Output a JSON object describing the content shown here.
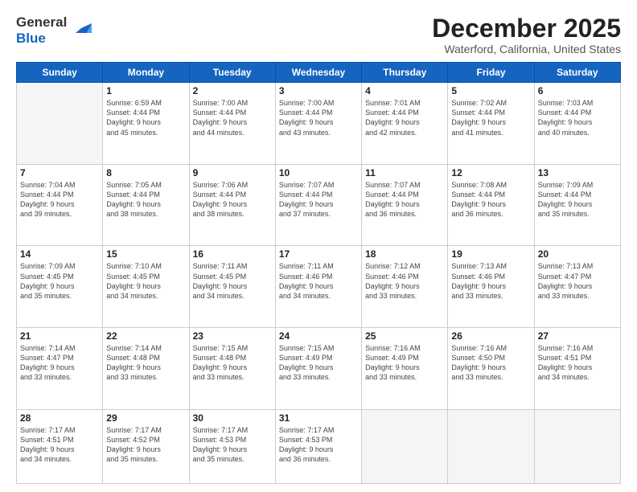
{
  "logo": {
    "general": "General",
    "blue": "Blue"
  },
  "title": "December 2025",
  "subtitle": "Waterford, California, United States",
  "days_of_week": [
    "Sunday",
    "Monday",
    "Tuesday",
    "Wednesday",
    "Thursday",
    "Friday",
    "Saturday"
  ],
  "weeks": [
    [
      {
        "day": "",
        "empty": true
      },
      {
        "day": "1",
        "sunrise": "Sunrise: 6:59 AM",
        "sunset": "Sunset: 4:44 PM",
        "daylight": "Daylight: 9 hours and 45 minutes."
      },
      {
        "day": "2",
        "sunrise": "Sunrise: 7:00 AM",
        "sunset": "Sunset: 4:44 PM",
        "daylight": "Daylight: 9 hours and 44 minutes."
      },
      {
        "day": "3",
        "sunrise": "Sunrise: 7:00 AM",
        "sunset": "Sunset: 4:44 PM",
        "daylight": "Daylight: 9 hours and 43 minutes."
      },
      {
        "day": "4",
        "sunrise": "Sunrise: 7:01 AM",
        "sunset": "Sunset: 4:44 PM",
        "daylight": "Daylight: 9 hours and 42 minutes."
      },
      {
        "day": "5",
        "sunrise": "Sunrise: 7:02 AM",
        "sunset": "Sunset: 4:44 PM",
        "daylight": "Daylight: 9 hours and 41 minutes."
      },
      {
        "day": "6",
        "sunrise": "Sunrise: 7:03 AM",
        "sunset": "Sunset: 4:44 PM",
        "daylight": "Daylight: 9 hours and 40 minutes."
      }
    ],
    [
      {
        "day": "7",
        "sunrise": "Sunrise: 7:04 AM",
        "sunset": "Sunset: 4:44 PM",
        "daylight": "Daylight: 9 hours and 39 minutes."
      },
      {
        "day": "8",
        "sunrise": "Sunrise: 7:05 AM",
        "sunset": "Sunset: 4:44 PM",
        "daylight": "Daylight: 9 hours and 38 minutes."
      },
      {
        "day": "9",
        "sunrise": "Sunrise: 7:06 AM",
        "sunset": "Sunset: 4:44 PM",
        "daylight": "Daylight: 9 hours and 38 minutes."
      },
      {
        "day": "10",
        "sunrise": "Sunrise: 7:07 AM",
        "sunset": "Sunset: 4:44 PM",
        "daylight": "Daylight: 9 hours and 37 minutes."
      },
      {
        "day": "11",
        "sunrise": "Sunrise: 7:07 AM",
        "sunset": "Sunset: 4:44 PM",
        "daylight": "Daylight: 9 hours and 36 minutes."
      },
      {
        "day": "12",
        "sunrise": "Sunrise: 7:08 AM",
        "sunset": "Sunset: 4:44 PM",
        "daylight": "Daylight: 9 hours and 36 minutes."
      },
      {
        "day": "13",
        "sunrise": "Sunrise: 7:09 AM",
        "sunset": "Sunset: 4:44 PM",
        "daylight": "Daylight: 9 hours and 35 minutes."
      }
    ],
    [
      {
        "day": "14",
        "sunrise": "Sunrise: 7:09 AM",
        "sunset": "Sunset: 4:45 PM",
        "daylight": "Daylight: 9 hours and 35 minutes."
      },
      {
        "day": "15",
        "sunrise": "Sunrise: 7:10 AM",
        "sunset": "Sunset: 4:45 PM",
        "daylight": "Daylight: 9 hours and 34 minutes."
      },
      {
        "day": "16",
        "sunrise": "Sunrise: 7:11 AM",
        "sunset": "Sunset: 4:45 PM",
        "daylight": "Daylight: 9 hours and 34 minutes."
      },
      {
        "day": "17",
        "sunrise": "Sunrise: 7:11 AM",
        "sunset": "Sunset: 4:46 PM",
        "daylight": "Daylight: 9 hours and 34 minutes."
      },
      {
        "day": "18",
        "sunrise": "Sunrise: 7:12 AM",
        "sunset": "Sunset: 4:46 PM",
        "daylight": "Daylight: 9 hours and 33 minutes."
      },
      {
        "day": "19",
        "sunrise": "Sunrise: 7:13 AM",
        "sunset": "Sunset: 4:46 PM",
        "daylight": "Daylight: 9 hours and 33 minutes."
      },
      {
        "day": "20",
        "sunrise": "Sunrise: 7:13 AM",
        "sunset": "Sunset: 4:47 PM",
        "daylight": "Daylight: 9 hours and 33 minutes."
      }
    ],
    [
      {
        "day": "21",
        "sunrise": "Sunrise: 7:14 AM",
        "sunset": "Sunset: 4:47 PM",
        "daylight": "Daylight: 9 hours and 33 minutes."
      },
      {
        "day": "22",
        "sunrise": "Sunrise: 7:14 AM",
        "sunset": "Sunset: 4:48 PM",
        "daylight": "Daylight: 9 hours and 33 minutes."
      },
      {
        "day": "23",
        "sunrise": "Sunrise: 7:15 AM",
        "sunset": "Sunset: 4:48 PM",
        "daylight": "Daylight: 9 hours and 33 minutes."
      },
      {
        "day": "24",
        "sunrise": "Sunrise: 7:15 AM",
        "sunset": "Sunset: 4:49 PM",
        "daylight": "Daylight: 9 hours and 33 minutes."
      },
      {
        "day": "25",
        "sunrise": "Sunrise: 7:16 AM",
        "sunset": "Sunset: 4:49 PM",
        "daylight": "Daylight: 9 hours and 33 minutes."
      },
      {
        "day": "26",
        "sunrise": "Sunrise: 7:16 AM",
        "sunset": "Sunset: 4:50 PM",
        "daylight": "Daylight: 9 hours and 33 minutes."
      },
      {
        "day": "27",
        "sunrise": "Sunrise: 7:16 AM",
        "sunset": "Sunset: 4:51 PM",
        "daylight": "Daylight: 9 hours and 34 minutes."
      }
    ],
    [
      {
        "day": "28",
        "sunrise": "Sunrise: 7:17 AM",
        "sunset": "Sunset: 4:51 PM",
        "daylight": "Daylight: 9 hours and 34 minutes."
      },
      {
        "day": "29",
        "sunrise": "Sunrise: 7:17 AM",
        "sunset": "Sunset: 4:52 PM",
        "daylight": "Daylight: 9 hours and 35 minutes."
      },
      {
        "day": "30",
        "sunrise": "Sunrise: 7:17 AM",
        "sunset": "Sunset: 4:53 PM",
        "daylight": "Daylight: 9 hours and 35 minutes."
      },
      {
        "day": "31",
        "sunrise": "Sunrise: 7:17 AM",
        "sunset": "Sunset: 4:53 PM",
        "daylight": "Daylight: 9 hours and 36 minutes."
      },
      {
        "day": "",
        "empty": true
      },
      {
        "day": "",
        "empty": true
      },
      {
        "day": "",
        "empty": true
      }
    ]
  ]
}
